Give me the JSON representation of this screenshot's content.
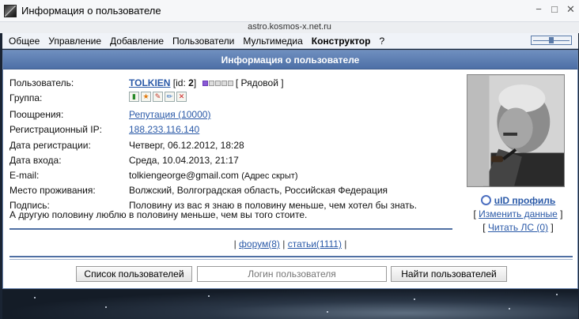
{
  "window": {
    "title": "Информация о пользователе"
  },
  "address": "astro.kosmos-x.net.ru",
  "menu": [
    "Общее",
    "Управление",
    "Добавление",
    "Пользователи",
    "Мультимедиа",
    "Конструктор",
    "?"
  ],
  "panel": {
    "title": "Информация о пользователе"
  },
  "user": {
    "label": "Пользователь:",
    "name": "TOLKIEN",
    "id_prefix": "[id: ",
    "id": "2",
    "id_suffix": "]",
    "rank": "[ Рядовой ]",
    "rank_level": 1,
    "rank_max": 5
  },
  "group": {
    "label": "Группа:",
    "icons": [
      "chart-icon",
      "star-icon",
      "edit-icon",
      "pencil-icon",
      "delete-icon"
    ]
  },
  "rewards": {
    "label": "Поощрения:",
    "value": "Репутация (10000)"
  },
  "reg_ip": {
    "label": "Регистрационный IP:",
    "value": "188.233.116.140"
  },
  "reg_date": {
    "label": "Дата регистрации:",
    "value": "Четверг, 06.12.2012, 18:28"
  },
  "login_date": {
    "label": "Дата входа:",
    "value": "Среда, 10.04.2013, 21:17"
  },
  "email": {
    "label": "E-mail:",
    "value": "tolkiengeorge@gmail.com",
    "note": "(Адрес скрыт)"
  },
  "location": {
    "label": "Место проживания:",
    "value": "Волжский, Волгоградская область, Российская Федерация"
  },
  "signature": {
    "label": "Подпись:",
    "line1": "Половину из вас я знаю в половину меньше, чем хотел бы знать.",
    "line2": "А другую половину люблю в половину меньше, чем вы того стоите."
  },
  "side": {
    "uid_profile": "uID профиль",
    "edit_open": "[ ",
    "edit_label": "Изменить данные",
    "edit_close": " ]",
    "pm_open": "[ ",
    "pm_label": "Читать ЛС (0)",
    "pm_close": " ]"
  },
  "stats": {
    "sep1": "| ",
    "forum": "форум(8)",
    "sep2": " | ",
    "articles": "статьи(1111)",
    "sep3": " |"
  },
  "search": {
    "users_list_button": "Список пользователей",
    "login_placeholder": "Логин пользователя",
    "find_button": "Найти пользователей"
  },
  "colors": {
    "header": "#4d6fa6",
    "link": "#2b5aa8",
    "rank_on": "#8a5ad6"
  }
}
